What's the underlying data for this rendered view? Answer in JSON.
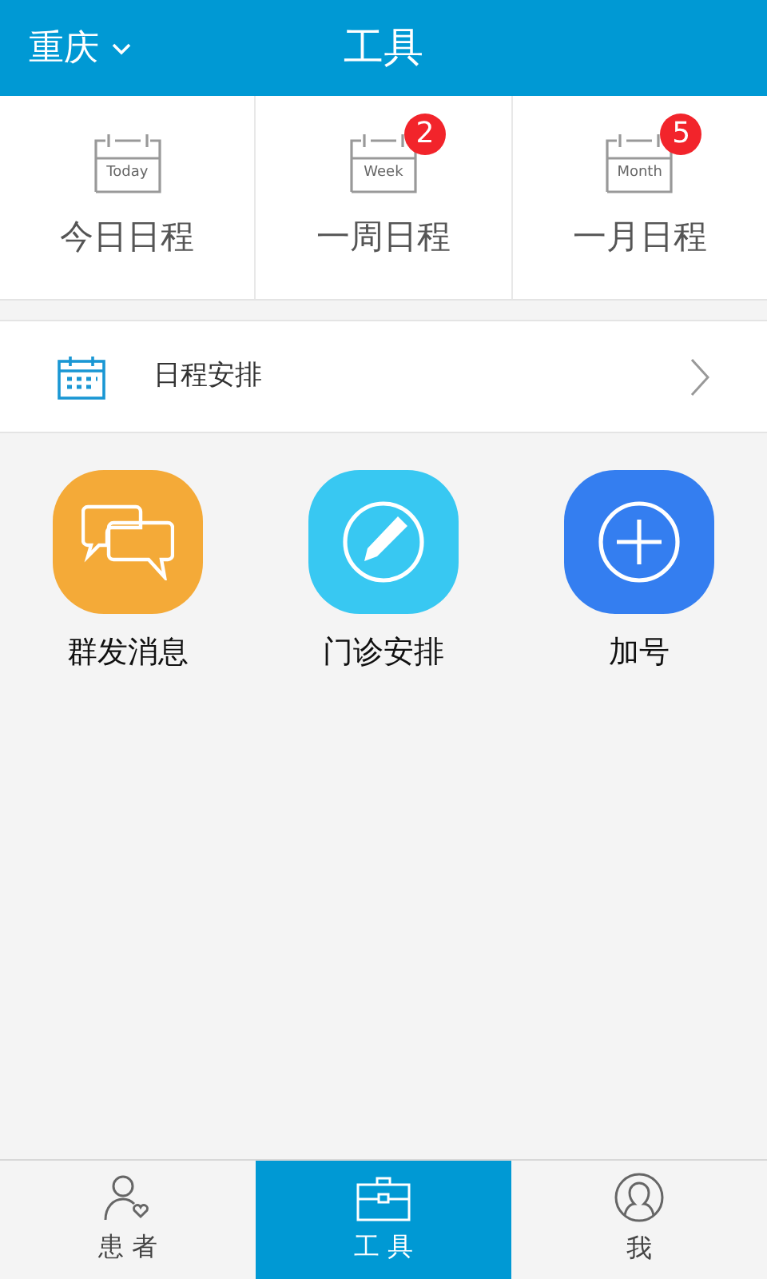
{
  "header": {
    "city": "重庆",
    "title": "工具"
  },
  "schedules": [
    {
      "tag": "Today",
      "label": "今日日程"
    },
    {
      "tag": "Week",
      "label": "一周日程",
      "badge": "2"
    },
    {
      "tag": "Month",
      "label": "一月日程",
      "badge": "5"
    }
  ],
  "arrange_row": {
    "label": "日程安排"
  },
  "apps": [
    {
      "kind": "chat",
      "label": "群发消息",
      "color": "#f4aa38"
    },
    {
      "kind": "edit",
      "label": "门诊安排",
      "color": "#38c8f2"
    },
    {
      "kind": "add",
      "label": "加号",
      "color": "#347ef0"
    }
  ],
  "tabs": [
    {
      "kind": "patients",
      "label": "患 者",
      "selected": false
    },
    {
      "kind": "tools",
      "label": "工 具",
      "selected": true
    },
    {
      "kind": "me",
      "label": "我",
      "selected": false
    }
  ]
}
